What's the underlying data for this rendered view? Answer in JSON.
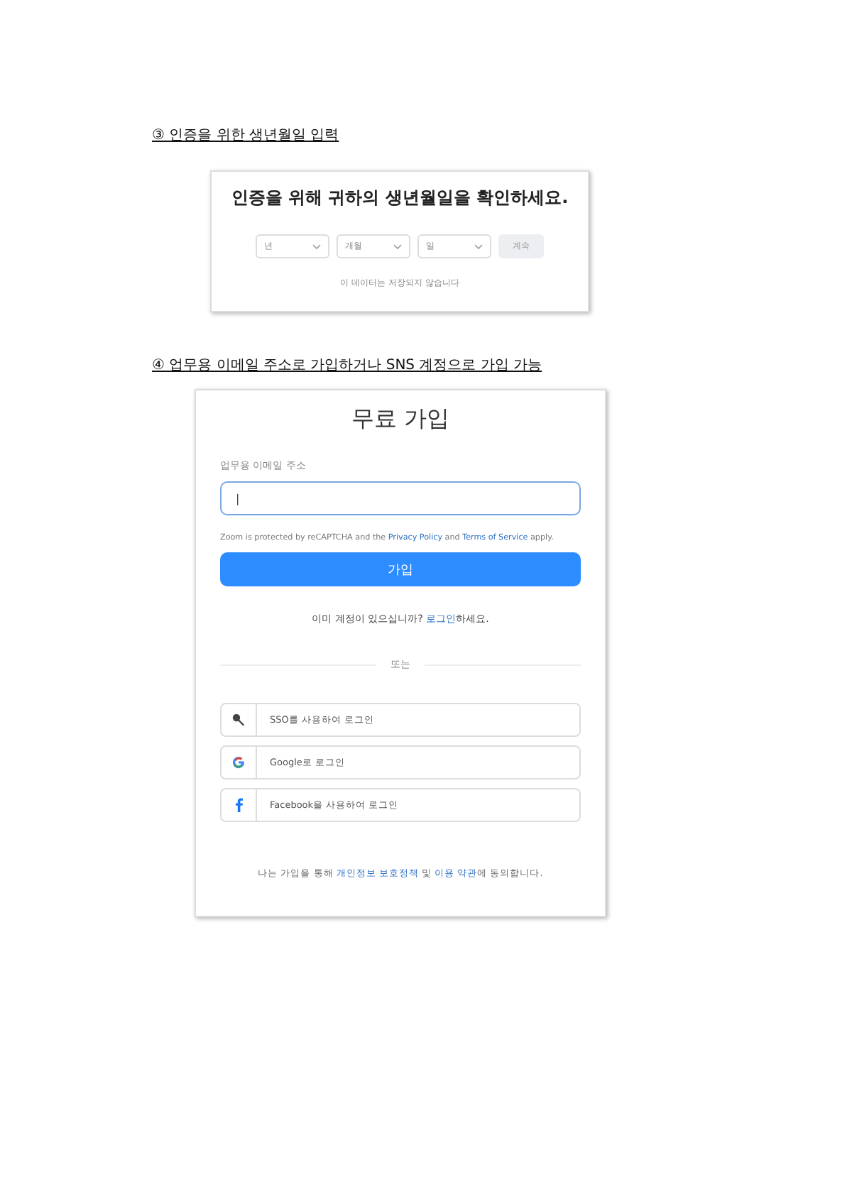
{
  "sections": [
    {
      "heading": "③ 인증을 위한 생년월일 입력",
      "kind": "birthdate",
      "card": {
        "title": "인증을 위해 귀하의 생년월일을 확인하세요.",
        "selects": [
          {
            "placeholder": "년"
          },
          {
            "placeholder": "개월"
          },
          {
            "placeholder": "일"
          }
        ],
        "button": {
          "label": "계속",
          "disabled": true
        },
        "note": "이 데이터는 저장되지 않습니다"
      }
    },
    {
      "heading": "④ 업무용 이메일 주소로 가입하거나 SNS 계정으로 가입 가능",
      "kind": "signup",
      "card": {
        "title": "무료 가입",
        "field_label": "업무용 이메일 주소",
        "field_value": "|",
        "recaptcha": [
          {
            "text": "Zoom is protected by reCAPTCHA and the ",
            "link": false
          },
          {
            "text": "Privacy Policy",
            "link": true
          },
          {
            "text": " and ",
            "link": false
          },
          {
            "text": "Terms of Service",
            "link": true
          },
          {
            "text": " apply.",
            "link": false
          }
        ],
        "button": {
          "label": "가입",
          "disabled": false
        },
        "login": [
          {
            "text": "이미 계정이 있으십니까? ",
            "link": false
          },
          {
            "text": "로그인",
            "link": true
          },
          {
            "text": "하세요.",
            "link": false
          }
        ],
        "divider": "또는",
        "social": [
          {
            "kind": "sso",
            "label": "SSO를 사용하여 로그인"
          },
          {
            "kind": "google",
            "label": "Google로 로그인"
          },
          {
            "kind": "facebook",
            "label": "Facebook을 사용하여 로그인"
          }
        ],
        "footer": [
          {
            "text": "나는 가입을 통해 ",
            "link": false
          },
          {
            "text": "개인정보 보호정책",
            "link": true
          },
          {
            "text": " 및 ",
            "link": false
          },
          {
            "text": "이용 약관",
            "link": true
          },
          {
            "text": "에 동의합니다.",
            "link": false
          }
        ]
      }
    }
  ]
}
